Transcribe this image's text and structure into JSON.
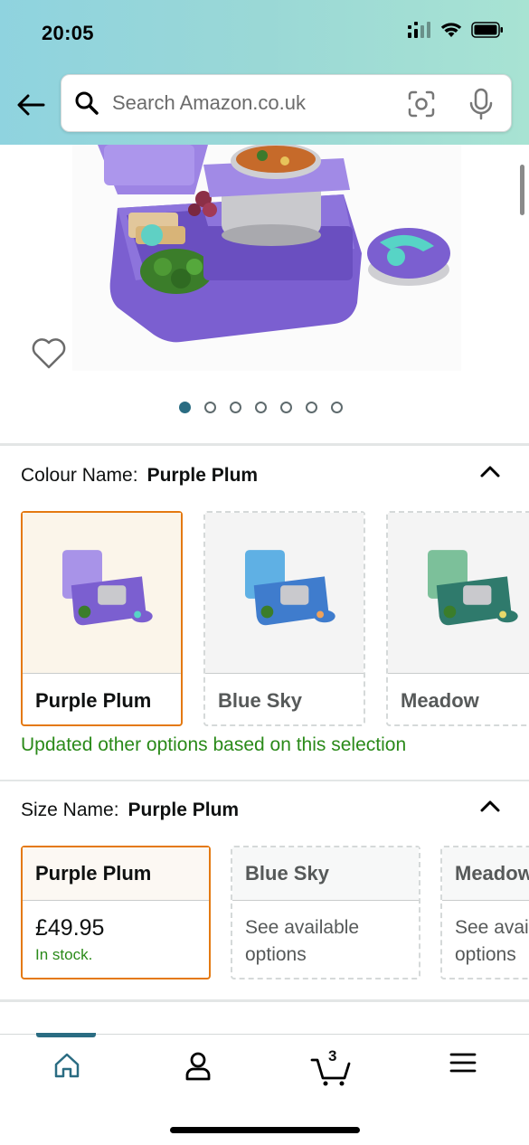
{
  "status_bar": {
    "time": "20:05"
  },
  "search": {
    "placeholder": "Search Amazon.co.uk"
  },
  "icons": {
    "back": "back-arrow-icon",
    "search": "search-icon",
    "camera": "camera-scan-icon",
    "mic": "microphone-icon",
    "heart": "heart-icon",
    "chevron": "chevron-up-icon",
    "home": "home-icon",
    "account": "account-icon",
    "cart": "cart-icon",
    "menu": "menu-icon"
  },
  "carousel": {
    "total_images": 7,
    "active_index": 0
  },
  "colour_section": {
    "label": "Colour Name:",
    "selected_value": "Purple Plum",
    "options": [
      {
        "label": "Purple Plum",
        "selected": true,
        "color": "#8a73d8"
      },
      {
        "label": "Blue Sky",
        "selected": false,
        "color": "#4a8fd6"
      },
      {
        "label": "Meadow",
        "selected": false,
        "color": "#5aa38a"
      }
    ],
    "updated_message": "Updated other options based on this selection"
  },
  "size_section": {
    "label": "Size Name:",
    "selected_value": "Purple Plum",
    "options": [
      {
        "label": "Purple Plum",
        "price": "£49.95",
        "stock": "In stock."
      },
      {
        "label": "Blue Sky",
        "availability": "See available options"
      },
      {
        "label": "Meadow",
        "availability": "See available options"
      }
    ]
  },
  "bottom_nav": {
    "cart_count": "3",
    "active": "home"
  },
  "colors": {
    "accent_selected_border": "#e47911",
    "in_stock_green": "#2a8a19",
    "active_nav": "#2a6c82",
    "header_gradient_start": "#8fd3df",
    "header_gradient_end": "#a8e3d3"
  }
}
